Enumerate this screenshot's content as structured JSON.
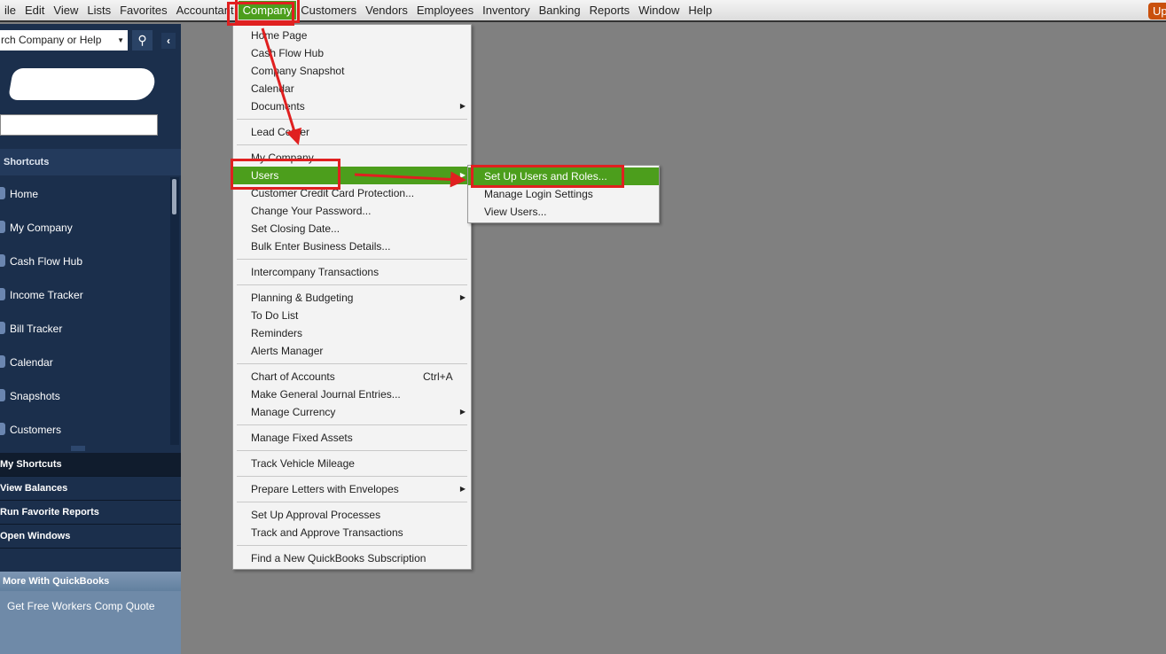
{
  "menubar": {
    "items": [
      "ile",
      "Edit",
      "View",
      "Lists",
      "Favorites",
      "Accountant",
      "Company",
      "Customers",
      "Vendors",
      "Employees",
      "Inventory",
      "Banking",
      "Reports",
      "Window",
      "Help"
    ],
    "active": "Company",
    "upgrade_label": "Up"
  },
  "sidebar": {
    "search_placeholder": "rch Company or Help",
    "shortcuts_heading": "Shortcuts",
    "shortcuts": [
      "Home",
      "My Company",
      "Cash Flow Hub",
      "Income Tracker",
      "Bill Tracker",
      "Calendar",
      "Snapshots",
      "Customers"
    ],
    "bottom": [
      "My Shortcuts",
      "View Balances",
      "Run Favorite Reports",
      "Open Windows"
    ],
    "more_heading": "More With QuickBooks",
    "more_item": "Get Free Workers Comp Quote"
  },
  "company_menu": {
    "groups": [
      [
        {
          "label": "Home Page"
        },
        {
          "label": "Cash Flow Hub"
        },
        {
          "label": "Company Snapshot"
        },
        {
          "label": "Calendar"
        },
        {
          "label": "Documents",
          "submenu": true
        }
      ],
      [
        {
          "label": "Lead Center"
        }
      ],
      [
        {
          "label": "My Company"
        },
        {
          "label": "Users",
          "submenu": true,
          "highlighted": true
        },
        {
          "label": "Customer Credit Card Protection..."
        },
        {
          "label": "Change Your Password..."
        },
        {
          "label": "Set Closing Date..."
        },
        {
          "label": "Bulk Enter Business Details..."
        }
      ],
      [
        {
          "label": "Intercompany Transactions"
        }
      ],
      [
        {
          "label": "Planning & Budgeting",
          "submenu": true
        },
        {
          "label": "To Do List"
        },
        {
          "label": "Reminders"
        },
        {
          "label": "Alerts Manager"
        }
      ],
      [
        {
          "label": "Chart of Accounts",
          "shortcut": "Ctrl+A"
        },
        {
          "label": "Make General Journal Entries..."
        },
        {
          "label": "Manage Currency",
          "submenu": true
        }
      ],
      [
        {
          "label": "Manage Fixed Assets"
        }
      ],
      [
        {
          "label": "Track Vehicle Mileage"
        }
      ],
      [
        {
          "label": "Prepare Letters with Envelopes",
          "submenu": true
        }
      ],
      [
        {
          "label": "Set Up Approval Processes"
        },
        {
          "label": "Track and Approve Transactions"
        }
      ],
      [
        {
          "label": "Find a New QuickBooks Subscription"
        }
      ]
    ]
  },
  "users_submenu": {
    "items": [
      "Set Up Users and Roles...",
      "Manage Login Settings",
      "View Users..."
    ],
    "highlighted": "Set Up Users and Roles..."
  },
  "colors": {
    "accent": "#4c9e1c",
    "annotation": "#e02020",
    "sidebar": "#1b2f4c"
  }
}
